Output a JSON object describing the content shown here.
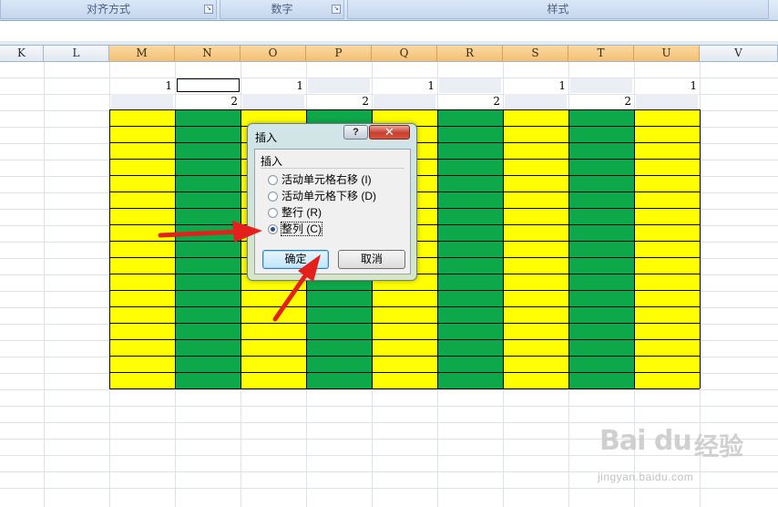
{
  "ribbon": {
    "groups": [
      {
        "label": "对齐方式"
      },
      {
        "label": "数字"
      },
      {
        "label": "样式"
      }
    ]
  },
  "columns": [
    "K",
    "L",
    "M",
    "N",
    "O",
    "P",
    "Q",
    "R",
    "S",
    "T",
    "U",
    "V"
  ],
  "selected_columns": [
    "M",
    "N",
    "O",
    "P",
    "Q",
    "R",
    "S",
    "T",
    "U"
  ],
  "row1_values": {
    "M": "1",
    "O": "1",
    "Q": "1",
    "S": "1",
    "U": "1"
  },
  "row2_values": {
    "N": "2",
    "P": "2",
    "R": "2",
    "T": "2"
  },
  "fill_colors": {
    "yellow": "#ffff00",
    "green": "#0da84a",
    "header_selected": "#f4c070"
  },
  "dialog": {
    "title": "插入",
    "help_glyph": "?",
    "close_glyph": "✕",
    "group_label": "插入",
    "options": [
      {
        "label": "活动单元格右移 (I)",
        "selected": false
      },
      {
        "label": "活动单元格下移 (D)",
        "selected": false
      },
      {
        "label": "整行 (R)",
        "selected": false
      },
      {
        "label": "整列 (C)",
        "selected": true
      }
    ],
    "ok_label": "确定",
    "cancel_label": "取消"
  },
  "watermark": {
    "logo": "Bai du",
    "cn": "经验",
    "url": "jingyan.baidu.com"
  }
}
